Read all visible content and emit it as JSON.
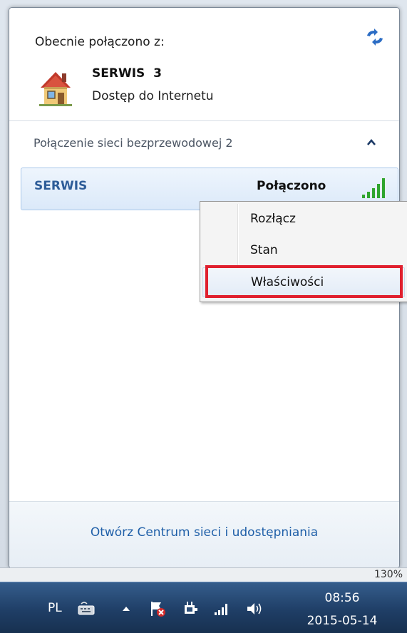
{
  "popup": {
    "currently_connected_label": "Obecnie połączono z:",
    "network": {
      "name": "SERWIS  3",
      "access": "Dostęp do Internetu"
    },
    "wireless_section_title": "Połączenie sieci bezprzewodowej 2",
    "networks": [
      {
        "ssid": "SERWIS",
        "status": "Połączono"
      }
    ],
    "footer_link": "Otwórz Centrum sieci i udostępniania"
  },
  "context_menu": {
    "items": [
      {
        "label": "Rozłącz"
      },
      {
        "label": "Stan"
      },
      {
        "label": "Właściwości"
      }
    ],
    "highlight_color": "#e0202e"
  },
  "behind_app": {
    "zoom_fragment": "130%"
  },
  "taskbar": {
    "language": "PL",
    "time": "08:56",
    "date": "2015-05-14",
    "icons": [
      "keyboard-icon",
      "show-hidden-icons-icon",
      "action-center-flag-icon",
      "power-icon",
      "network-signal-icon",
      "volume-icon"
    ]
  },
  "colors": {
    "link_blue": "#1f5fa8",
    "ssid_blue": "#2d5c98",
    "signal_green": "#2fa52f",
    "taskbar_blue": "#1f3e66"
  }
}
